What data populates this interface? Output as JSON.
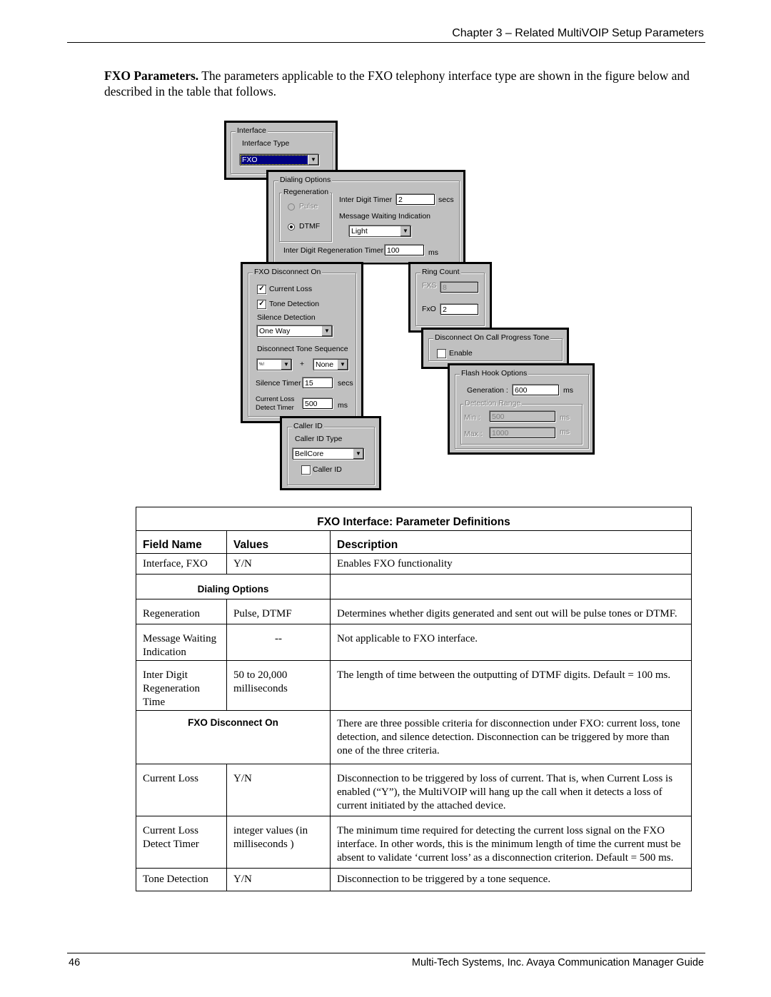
{
  "header": {
    "running_title": "Chapter 3 – Related MultiVOIP Setup Parameters"
  },
  "intro": {
    "lead": "FXO Parameters.",
    "text": "  The parameters applicable to the FXO telephony interface type are shown in the figure below and described in the table that follows."
  },
  "figure": {
    "interface": {
      "group_title": "Interface",
      "type_label": "Interface Type",
      "type_value": "FXO"
    },
    "dialing_options": {
      "group_title": "Dialing Options",
      "regeneration_title": "Regeneration",
      "pulse_label": "Pulse",
      "dtmf_label": "DTMF",
      "selected": "DTMF",
      "inter_digit_timer_label": "Inter Digit Timer",
      "inter_digit_timer_value": "2",
      "inter_digit_timer_unit": "secs",
      "mwi_label": "Message Waiting Indication",
      "mwi_value": "Light",
      "regen_timer_label": "Inter Digit Regeneration Timer",
      "regen_timer_value": "100",
      "regen_timer_unit": "ms"
    },
    "fxo_disconnect": {
      "group_title": "FXO Disconnect On",
      "current_loss_label": "Current Loss",
      "current_loss_checked": true,
      "tone_detection_label": "Tone Detection",
      "tone_detection_checked": true,
      "silence_detection_label": "Silence Detection",
      "silence_detection_value": "One Way",
      "tone_sequence_label": "Disconnect Tone Sequence",
      "tone_sequence_1": "%!",
      "plus": "+",
      "tone_sequence_2": "None",
      "silence_timer_label": "Silence Timer",
      "silence_timer_value": "15",
      "silence_timer_unit": "secs",
      "cl_timer_label_1": "Current Loss",
      "cl_timer_label_2": "Detect Timer",
      "cl_timer_value": "500",
      "cl_timer_unit": "ms"
    },
    "ring_count": {
      "group_title": "Ring Count",
      "fxs_label": "FXS",
      "fxs_value": "8",
      "fxo_label": "FxO",
      "fxo_value": "2"
    },
    "call_progress": {
      "group_title": "Disconnect On Call Progress Tone",
      "enable_label": "Enable",
      "enable_checked": false
    },
    "flash_hook": {
      "group_title": "Flash Hook Options",
      "generation_label": "Generation :",
      "generation_value": "600",
      "generation_unit": "ms",
      "detection_title": "Detection Range",
      "min_label": "Min :",
      "min_value": "500",
      "min_unit": "ms",
      "max_label": "Max :",
      "max_value": "1000",
      "max_unit": "ms"
    },
    "caller_id": {
      "group_title": "Caller ID",
      "type_label": "Caller ID Type",
      "type_value": "BellCore",
      "checkbox_label": "Caller ID",
      "checked": false
    }
  },
  "table": {
    "title": "FXO Interface: Parameter Definitions",
    "columns": [
      "Field Name",
      "Values",
      "Description"
    ],
    "rows": [
      {
        "field": "Interface, FXO",
        "values": "Y/N",
        "description": "Enables FXO functionality"
      },
      {
        "section": "Dialing Options",
        "description": ""
      },
      {
        "field": "Regeneration",
        "values": "Pulse, DTMF",
        "description": "Determines whether digits generated and sent out will be pulse tones or DTMF."
      },
      {
        "field": "Message Waiting Indication",
        "values": "--",
        "description": "Not applicable to FXO interface."
      },
      {
        "field": "Inter Digit Regeneration Time",
        "values": "50 to 20,000 milliseconds",
        "description": "The length of time between the outputting of DTMF digits. Default = 100 ms."
      },
      {
        "section": "FXO Disconnect On",
        "description": "There are three possible criteria for disconnection under FXO: current loss, tone detection, and silence detection.  Disconnection can be triggered by more than one of the three criteria."
      },
      {
        "field": "Current Loss",
        "values": "Y/N",
        "description": "Disconnection to be triggered by loss of current.  That is, when Current Loss is enabled (“Y”), the MultiVOIP will hang up the call when it detects a loss of current initiated by the attached device."
      },
      {
        "field": "Current Loss Detect Timer",
        "values": "integer values (in milliseconds )",
        "description": "The minimum time required for detecting the current loss signal on the FXO interface.  In other words, this is the  minimum length of time the current must be absent to validate ‘current loss’ as a disconnection criterion. Default = 500 ms."
      },
      {
        "field": "Tone Detection",
        "values": "Y/N",
        "description": "Disconnection to be triggered by a tone sequence."
      }
    ]
  },
  "footer": {
    "page_number": "46",
    "book_title": "Multi-Tech Systems, Inc. Avaya Communication Manager Guide"
  }
}
